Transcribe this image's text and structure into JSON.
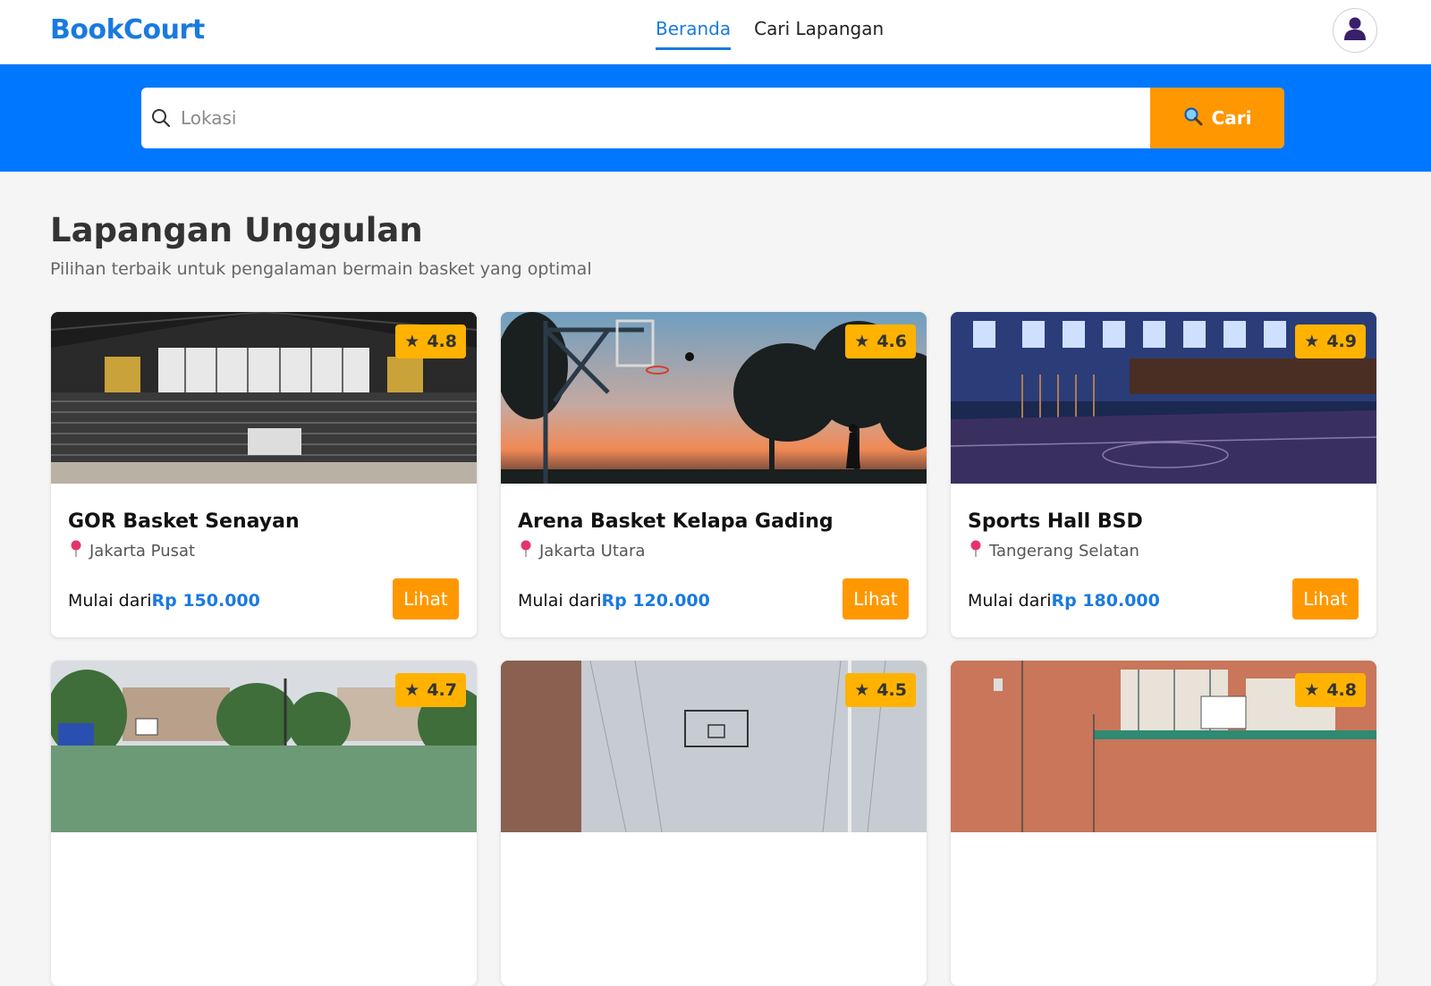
{
  "header": {
    "brand": "BookCourt",
    "nav": [
      {
        "label": "Beranda",
        "active": true
      },
      {
        "label": "Cari Lapangan",
        "active": false
      }
    ],
    "avatar_icon": "user-icon"
  },
  "search": {
    "placeholder": "Lokasi",
    "value": "",
    "button_label": "Cari",
    "button_icon": "search-icon"
  },
  "section": {
    "title": "Lapangan Unggulan",
    "subtitle": "Pilihan terbaik untuk pengalaman bermain basket yang optimal"
  },
  "price_prefix": "Mulai dari",
  "cards": [
    {
      "name": "GOR Basket Senayan",
      "location": "Jakarta Pusat",
      "rating": "4.8",
      "price": "Rp 150.000",
      "button": "Lihat",
      "image": "indoor-arena-photo"
    },
    {
      "name": "Arena Basket Kelapa Gading",
      "location": "Jakarta Utara",
      "rating": "4.6",
      "price": "Rp 120.000",
      "button": "Lihat",
      "image": "sunset-outdoor-court-photo"
    },
    {
      "name": "Sports Hall BSD",
      "location": "Tangerang Selatan",
      "rating": "4.9",
      "price": "Rp 180.000",
      "button": "Lihat",
      "image": "indoor-hall-photo"
    },
    {
      "name": "",
      "location": "",
      "rating": "4.7",
      "price": "",
      "button": "",
      "image": "outdoor-court-trees-photo"
    },
    {
      "name": "",
      "location": "",
      "rating": "4.5",
      "price": "",
      "button": "",
      "image": "netted-court-photo"
    },
    {
      "name": "",
      "location": "",
      "rating": "4.8",
      "price": "",
      "button": "",
      "image": "brick-building-court-photo"
    }
  ],
  "colors": {
    "brand": "#1a7ae0",
    "band": "#0077ff",
    "accent": "#ff9800",
    "rating_badge": "#ffb300"
  }
}
